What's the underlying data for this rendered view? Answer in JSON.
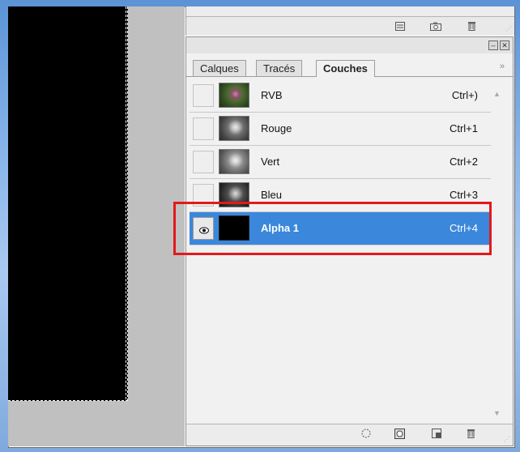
{
  "panel": {
    "tabs": [
      {
        "label": "Calques"
      },
      {
        "label": "Tracés"
      },
      {
        "label": "Couches"
      }
    ],
    "menu_glyph": "»",
    "minimize_glyph": "–",
    "close_glyph": "✕"
  },
  "channels": [
    {
      "name": "RVB",
      "shortcut": "Ctrl+)",
      "thumb": "color",
      "visible": false,
      "selected": false
    },
    {
      "name": "Rouge",
      "shortcut": "Ctrl+1",
      "thumb": "gray",
      "visible": false,
      "selected": false
    },
    {
      "name": "Vert",
      "shortcut": "Ctrl+2",
      "thumb": "gray",
      "visible": false,
      "selected": false
    },
    {
      "name": "Bleu",
      "shortcut": "Ctrl+3",
      "thumb": "gray",
      "visible": false,
      "selected": false
    },
    {
      "name": "Alpha 1",
      "shortcut": "Ctrl+4",
      "thumb": "black",
      "visible": true,
      "selected": true
    }
  ],
  "icons": {
    "upper_toolbar": [
      "new-layer-icon",
      "camera-icon",
      "trash-icon"
    ],
    "footer": [
      "load-selection-icon",
      "save-selection-icon",
      "new-channel-icon",
      "trash-icon"
    ]
  },
  "colors": {
    "selection": "#3b87dc",
    "highlight_box": "#e3191c"
  }
}
